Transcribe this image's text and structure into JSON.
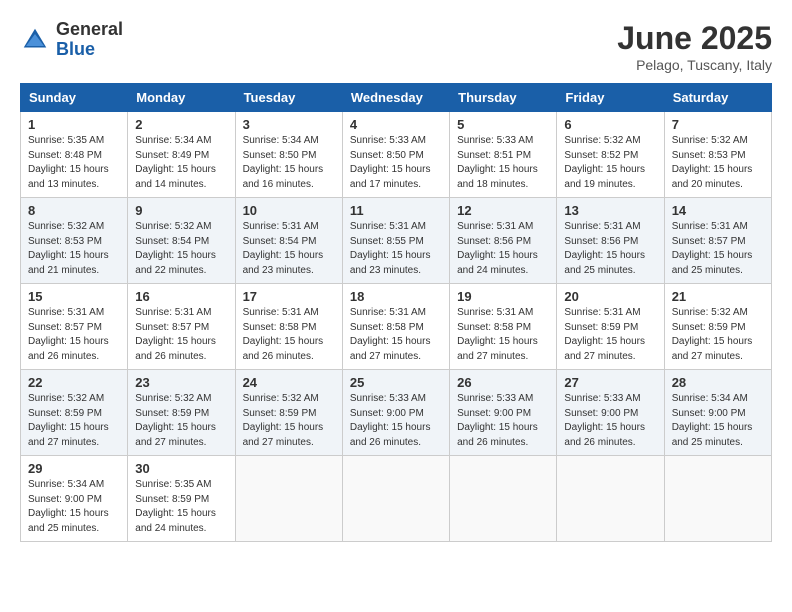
{
  "logo": {
    "general": "General",
    "blue": "Blue"
  },
  "title": "June 2025",
  "location": "Pelago, Tuscany, Italy",
  "days_of_week": [
    "Sunday",
    "Monday",
    "Tuesday",
    "Wednesday",
    "Thursday",
    "Friday",
    "Saturday"
  ],
  "weeks": [
    [
      {
        "day": "1",
        "sunrise": "5:35 AM",
        "sunset": "8:48 PM",
        "daylight": "15 hours and 13 minutes."
      },
      {
        "day": "2",
        "sunrise": "5:34 AM",
        "sunset": "8:49 PM",
        "daylight": "15 hours and 14 minutes."
      },
      {
        "day": "3",
        "sunrise": "5:34 AM",
        "sunset": "8:50 PM",
        "daylight": "15 hours and 16 minutes."
      },
      {
        "day": "4",
        "sunrise": "5:33 AM",
        "sunset": "8:50 PM",
        "daylight": "15 hours and 17 minutes."
      },
      {
        "day": "5",
        "sunrise": "5:33 AM",
        "sunset": "8:51 PM",
        "daylight": "15 hours and 18 minutes."
      },
      {
        "day": "6",
        "sunrise": "5:32 AM",
        "sunset": "8:52 PM",
        "daylight": "15 hours and 19 minutes."
      },
      {
        "day": "7",
        "sunrise": "5:32 AM",
        "sunset": "8:53 PM",
        "daylight": "15 hours and 20 minutes."
      }
    ],
    [
      {
        "day": "8",
        "sunrise": "5:32 AM",
        "sunset": "8:53 PM",
        "daylight": "15 hours and 21 minutes."
      },
      {
        "day": "9",
        "sunrise": "5:32 AM",
        "sunset": "8:54 PM",
        "daylight": "15 hours and 22 minutes."
      },
      {
        "day": "10",
        "sunrise": "5:31 AM",
        "sunset": "8:54 PM",
        "daylight": "15 hours and 23 minutes."
      },
      {
        "day": "11",
        "sunrise": "5:31 AM",
        "sunset": "8:55 PM",
        "daylight": "15 hours and 23 minutes."
      },
      {
        "day": "12",
        "sunrise": "5:31 AM",
        "sunset": "8:56 PM",
        "daylight": "15 hours and 24 minutes."
      },
      {
        "day": "13",
        "sunrise": "5:31 AM",
        "sunset": "8:56 PM",
        "daylight": "15 hours and 25 minutes."
      },
      {
        "day": "14",
        "sunrise": "5:31 AM",
        "sunset": "8:57 PM",
        "daylight": "15 hours and 25 minutes."
      }
    ],
    [
      {
        "day": "15",
        "sunrise": "5:31 AM",
        "sunset": "8:57 PM",
        "daylight": "15 hours and 26 minutes."
      },
      {
        "day": "16",
        "sunrise": "5:31 AM",
        "sunset": "8:57 PM",
        "daylight": "15 hours and 26 minutes."
      },
      {
        "day": "17",
        "sunrise": "5:31 AM",
        "sunset": "8:58 PM",
        "daylight": "15 hours and 26 minutes."
      },
      {
        "day": "18",
        "sunrise": "5:31 AM",
        "sunset": "8:58 PM",
        "daylight": "15 hours and 27 minutes."
      },
      {
        "day": "19",
        "sunrise": "5:31 AM",
        "sunset": "8:58 PM",
        "daylight": "15 hours and 27 minutes."
      },
      {
        "day": "20",
        "sunrise": "5:31 AM",
        "sunset": "8:59 PM",
        "daylight": "15 hours and 27 minutes."
      },
      {
        "day": "21",
        "sunrise": "5:32 AM",
        "sunset": "8:59 PM",
        "daylight": "15 hours and 27 minutes."
      }
    ],
    [
      {
        "day": "22",
        "sunrise": "5:32 AM",
        "sunset": "8:59 PM",
        "daylight": "15 hours and 27 minutes."
      },
      {
        "day": "23",
        "sunrise": "5:32 AM",
        "sunset": "8:59 PM",
        "daylight": "15 hours and 27 minutes."
      },
      {
        "day": "24",
        "sunrise": "5:32 AM",
        "sunset": "8:59 PM",
        "daylight": "15 hours and 27 minutes."
      },
      {
        "day": "25",
        "sunrise": "5:33 AM",
        "sunset": "9:00 PM",
        "daylight": "15 hours and 26 minutes."
      },
      {
        "day": "26",
        "sunrise": "5:33 AM",
        "sunset": "9:00 PM",
        "daylight": "15 hours and 26 minutes."
      },
      {
        "day": "27",
        "sunrise": "5:33 AM",
        "sunset": "9:00 PM",
        "daylight": "15 hours and 26 minutes."
      },
      {
        "day": "28",
        "sunrise": "5:34 AM",
        "sunset": "9:00 PM",
        "daylight": "15 hours and 25 minutes."
      }
    ],
    [
      {
        "day": "29",
        "sunrise": "5:34 AM",
        "sunset": "9:00 PM",
        "daylight": "15 hours and 25 minutes."
      },
      {
        "day": "30",
        "sunrise": "5:35 AM",
        "sunset": "8:59 PM",
        "daylight": "15 hours and 24 minutes."
      },
      null,
      null,
      null,
      null,
      null
    ]
  ],
  "labels": {
    "sunrise": "Sunrise:",
    "sunset": "Sunset:",
    "daylight": "Daylight:"
  }
}
